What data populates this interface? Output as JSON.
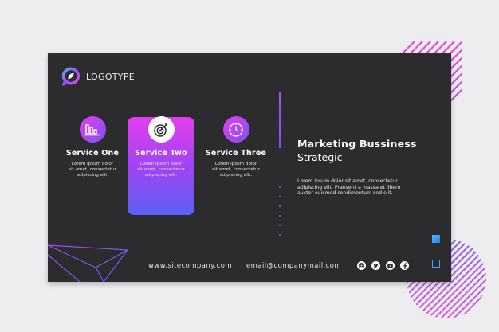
{
  "brand": {
    "logo_text": "LOGOTYPE"
  },
  "colors": {
    "card_bg": "#2c2b2e",
    "accent_pink": "#e23df0",
    "accent_purple": "#9b45f2",
    "accent_blue": "#5a63f6",
    "square_blue": "#3aa7f5"
  },
  "services": [
    {
      "title": "Service One",
      "icon": "bar-chart-icon",
      "description": [
        "Lorem ipsum dolor",
        "sit amet, consectetur",
        "adipiscing elit."
      ]
    },
    {
      "title": "Service Two",
      "icon": "target-icon",
      "description": [
        "Lorem ipsum dolor",
        "sit amet, consectetur",
        "adipiscing elit."
      ]
    },
    {
      "title": "Service Three",
      "icon": "clock-icon",
      "description": [
        "Lorem ipsum dolor",
        "sit amet, consectetur",
        "adipiscing elit."
      ]
    }
  ],
  "headline": {
    "title": "Marketing Bussiness",
    "subtitle": "Strategic"
  },
  "body": {
    "lines": [
      "Lorem ipsum dolor sit amet, consectetur",
      "adipiscing elit. Praesent a massa et libero",
      "auctor euismod condimentum sed elit."
    ]
  },
  "footer": {
    "website": "www.sitecompany.com",
    "email": "email@companymail.com",
    "socials": [
      "instagram-icon",
      "twitter-icon",
      "youtube-icon",
      "facebook-icon"
    ]
  }
}
